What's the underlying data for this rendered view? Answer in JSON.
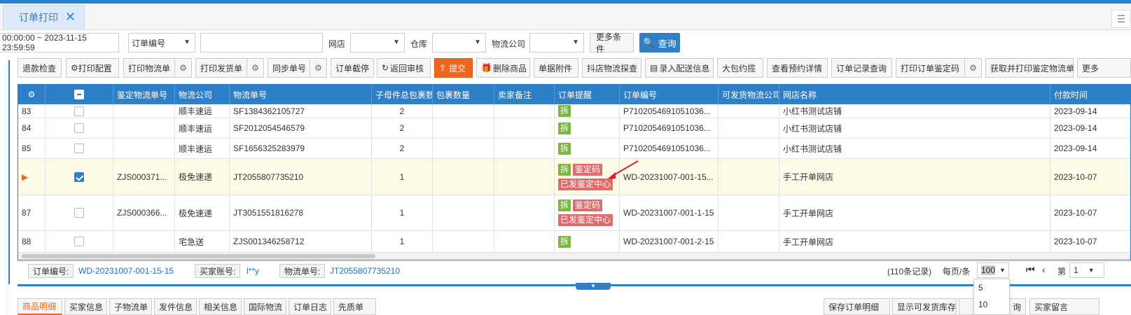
{
  "tab": {
    "title": "订单打印",
    "close": "✕"
  },
  "filters": {
    "date_range": "00:00:00 ~ 2023-11-15 23:59:59",
    "order_field": "订单编号",
    "search_value": "",
    "shop_label": "网店",
    "warehouse_label": "仓库",
    "logistics_label": "物流公司",
    "more": "更多条件",
    "query": "查询"
  },
  "toolbar": [
    {
      "label": "退款检查"
    },
    {
      "label": "打印配置"
    },
    {
      "label": "打印物流单"
    },
    {
      "label": "打印发货单"
    },
    {
      "label": "同步单号"
    },
    {
      "label": "订单截停"
    },
    {
      "label": "返回审核"
    },
    {
      "label": "提交"
    },
    {
      "label": "删除商品"
    },
    {
      "label": "单据附件"
    },
    {
      "label": "抖店物流探查"
    },
    {
      "label": "录入配送信息"
    },
    {
      "label": "大包约揽"
    },
    {
      "label": "查看预约详情"
    },
    {
      "label": "订单记录查询"
    },
    {
      "label": "打印订单鉴定码"
    },
    {
      "label": "获取并打印鉴定物流单"
    },
    {
      "label": "更多"
    }
  ],
  "grid": {
    "headers": [
      "鉴定物流单号",
      "物流公司",
      "物流单号",
      "子母件总包裹数",
      "包裹数量",
      "卖家备注",
      "订单提醒",
      "订单编号",
      "可发货物流公司",
      "网店名称",
      "付款时间"
    ],
    "rows": [
      {
        "no": "83",
        "jd": "",
        "company": "顺丰速运",
        "tracking": "SF1384362105727",
        "pkgs": "2",
        "tags": [
          "拆"
        ],
        "tags2": [],
        "order": "P7102054691051036...",
        "shop": "小红书测试店铺",
        "paid": "2023-09-14"
      },
      {
        "no": "84",
        "jd": "",
        "company": "顺丰速运",
        "tracking": "SF2012054546579",
        "pkgs": "2",
        "tags": [
          "拆"
        ],
        "tags2": [],
        "order": "P7102054691051036...",
        "shop": "小红书测试店铺",
        "paid": "2023-09-14"
      },
      {
        "no": "85",
        "jd": "",
        "company": "顺丰速运",
        "tracking": "SF1656325283979",
        "pkgs": "2",
        "tags": [
          "拆"
        ],
        "tags2": [],
        "order": "P7102054691051036...",
        "shop": "小红书测试店铺",
        "paid": "2023-09-14"
      },
      {
        "no": "",
        "jd": "ZJS000371...",
        "company": "极免速递",
        "tracking": "JT2055807735210",
        "pkgs": "1",
        "tags": [
          "拆",
          "鉴定码"
        ],
        "tags2": [
          "已发鉴定中心"
        ],
        "order": "WD-20231007-001-15...",
        "shop": "手工开单网店",
        "paid": "2023-10-07"
      },
      {
        "no": "87",
        "jd": "ZJS000366...",
        "company": "极免速递",
        "tracking": "JT3051551816278",
        "pkgs": "1",
        "tags": [
          "拆",
          "鉴定码"
        ],
        "tags2": [
          "已发鉴定中心"
        ],
        "order": "WD-20231007-001-1-15",
        "shop": "手工开单网店",
        "paid": "2023-10-07"
      },
      {
        "no": "88",
        "jd": "",
        "company": "宅急送",
        "tracking": "ZJS001346258712",
        "pkgs": "1",
        "tags": [
          "拆"
        ],
        "tags2": [],
        "order": "WD-20231007-001-2-15",
        "shop": "手工开单网店",
        "paid": "2023-10-07"
      }
    ]
  },
  "statusbar": {
    "order_label": "订单编号:",
    "order_value": "WD-20231007-001-15-15",
    "buyer_label": "买家账号:",
    "buyer_value": "l**y",
    "tracking_label": "物流单号:",
    "tracking_value": "JT2055807735210",
    "records": "(110条记录)",
    "per_page_label": "每页/条",
    "per_page": "100",
    "page_label": "第",
    "page": "1"
  },
  "per_page_options": [
    "5",
    "10"
  ],
  "bottom_tabs": [
    "商品明细",
    "买家信息",
    "子物流单",
    "发件信息",
    "相关信息",
    "国际物流",
    "订单日志",
    "先质单"
  ],
  "bottom_right": {
    "save": "保存订单明细",
    "show_stock": "显示可发货库存",
    "query_short": "询",
    "buyer_msg": "买家留言"
  },
  "colors": {
    "primary": "#2f7fc6",
    "submit": "#f0651e",
    "tag_split": "#7cb83c",
    "tag_identify": "#e06b6b"
  }
}
